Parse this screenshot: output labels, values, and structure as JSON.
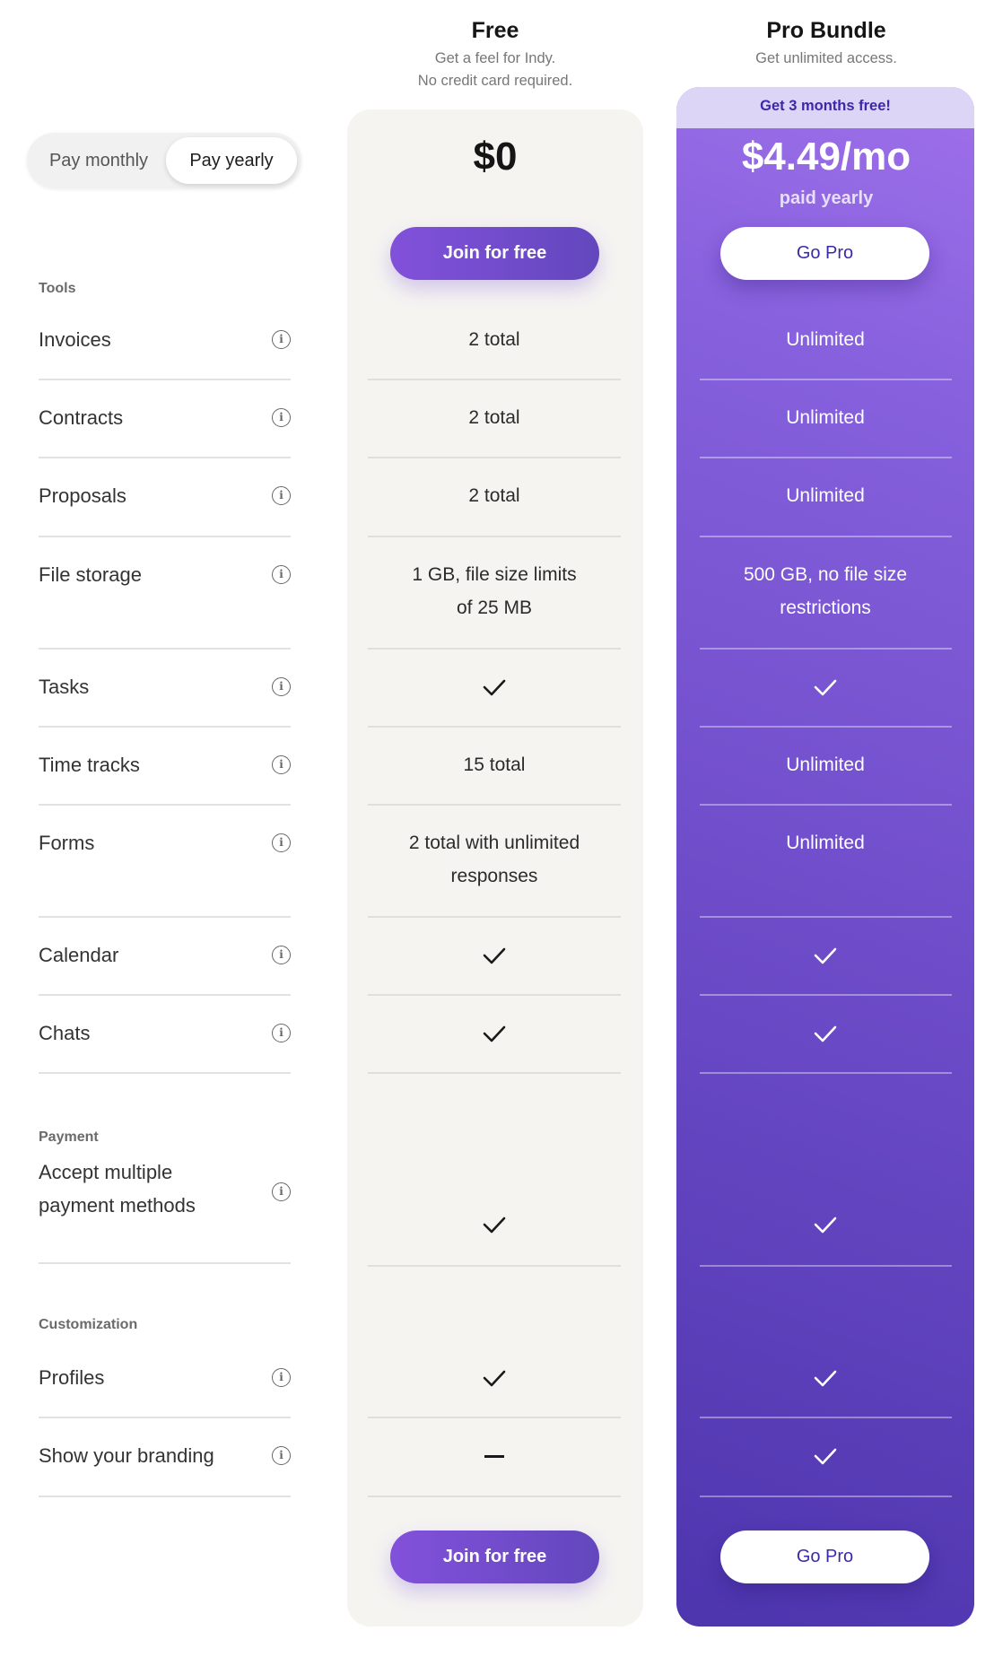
{
  "billing_toggle": {
    "options": [
      "Pay monthly",
      "Pay yearly"
    ],
    "selected": "Pay yearly"
  },
  "plans": {
    "free": {
      "title": "Free",
      "subtitle_lines": [
        "Get a feel for Indy.",
        "No credit card required."
      ],
      "price": "$0",
      "cta_label": "Join for free"
    },
    "pro": {
      "title": "Pro Bundle",
      "subtitle_lines": [
        "Get unlimited access."
      ],
      "banner": "Get 3 months free!",
      "price": "$4.49/mo",
      "price_note": "paid yearly",
      "cta_label": "Go Pro"
    }
  },
  "colors": {
    "accent_purple": "#7b4fd8",
    "pro_gradient_top": "#9f70ea",
    "pro_gradient_bottom": "#4d35ae",
    "banner_bg": "#ddd5f6",
    "banner_text": "#3c28a8",
    "free_card_bg": "#f5f4f1"
  },
  "sections": [
    {
      "label": "Tools",
      "features": [
        {
          "name": "Invoices",
          "free": "2 total",
          "pro": "Unlimited"
        },
        {
          "name": "Contracts",
          "free": "2 total",
          "pro": "Unlimited"
        },
        {
          "name": "Proposals",
          "free": "2 total",
          "pro": "Unlimited"
        },
        {
          "name": "File storage",
          "free": "1 GB, file size limits of 25 MB",
          "pro": "500 GB, no file size restrictions"
        },
        {
          "name": "Tasks",
          "free": "check",
          "pro": "check"
        },
        {
          "name": "Time tracks",
          "free": "15 total",
          "pro": "Unlimited"
        },
        {
          "name": "Forms",
          "free": "2 total with unlimited responses",
          "pro": "Unlimited"
        },
        {
          "name": "Calendar",
          "free": "check",
          "pro": "check"
        },
        {
          "name": "Chats",
          "free": "check",
          "pro": "check"
        }
      ]
    },
    {
      "label": "Payment",
      "features": [
        {
          "name": "Accept multiple payment methods",
          "free": "check",
          "pro": "check"
        }
      ]
    },
    {
      "label": "Customization",
      "features": [
        {
          "name": "Profiles",
          "free": "check",
          "pro": "check"
        },
        {
          "name": "Show your branding",
          "free": "dash",
          "pro": "check"
        }
      ]
    }
  ],
  "icons": {
    "info": "info-circle-icon",
    "included": "checkmark-icon",
    "not_included": "dash-icon"
  }
}
